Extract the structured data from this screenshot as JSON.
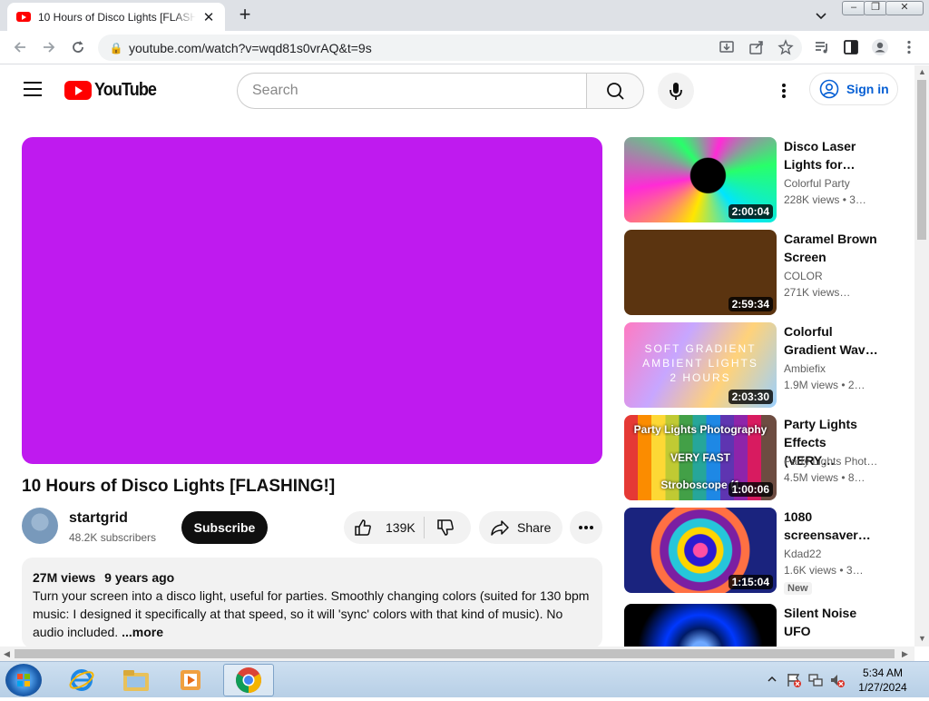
{
  "browser": {
    "tab_title": "10 Hours of Disco Lights [FLASHING!]",
    "url": "youtube.com/watch?v=wqd81s0vrAQ&t=9s"
  },
  "youtube": {
    "logo_text": "YouTube",
    "search_placeholder": "Search",
    "sign_in_label": "Sign in"
  },
  "video": {
    "player_color": "#bf1aef",
    "title": "10 Hours of Disco Lights [FLASHING!]",
    "channel": "startgrid",
    "subscribers": "48.2K subscribers",
    "subscribe_label": "Subscribe",
    "likes": "139K",
    "share_label": "Share",
    "views": "27M views",
    "age": "9 years ago",
    "description": "Turn your screen into a disco light, useful for parties. Smoothly changing colors (suited for 130 bpm music: I designed it specifically at that speed, so it will 'sync' colors with that kind of music). No audio included.",
    "more_label": "...more"
  },
  "related": [
    {
      "title": "Disco Laser Lights for…",
      "channel": "Colorful Party",
      "meta": "228K views  • 3…",
      "duration": "2:00:04",
      "thumb": "laser"
    },
    {
      "title": "Caramel Brown Screen",
      "channel": "COLOR",
      "meta": "271K views…",
      "duration": "2:59:34",
      "thumb": "brown"
    },
    {
      "title": "Colorful Gradient Wav…",
      "channel": "Ambiefix",
      "meta": "1.9M views  • 2…",
      "duration": "2:03:30",
      "thumb": "gradient",
      "thumb_text": [
        "SOFT GRADIENT",
        "AMBIENT LIGHTS",
        "2 HOURS"
      ]
    },
    {
      "title": "Party Lights Effects (VERY…",
      "channel": "Party Lights Phot…",
      "meta": "4.5M views  • 8…",
      "duration": "1:00:06",
      "thumb": "stripes",
      "thumb_text": [
        "Party Lights Photography",
        "VERY FAST",
        "Stroboscope (1"
      ]
    },
    {
      "title": "1080 screensaver…",
      "channel": "Kdad22",
      "meta": "1.6K views  • 3…",
      "duration": "1:15:04",
      "badge": "New",
      "thumb": "mandala"
    },
    {
      "title": "Silent Noise UFO",
      "channel": "",
      "meta": "",
      "duration": "",
      "thumb": "tunnel"
    }
  ],
  "taskbar": {
    "time": "5:34 AM",
    "date": "1/27/2024"
  }
}
